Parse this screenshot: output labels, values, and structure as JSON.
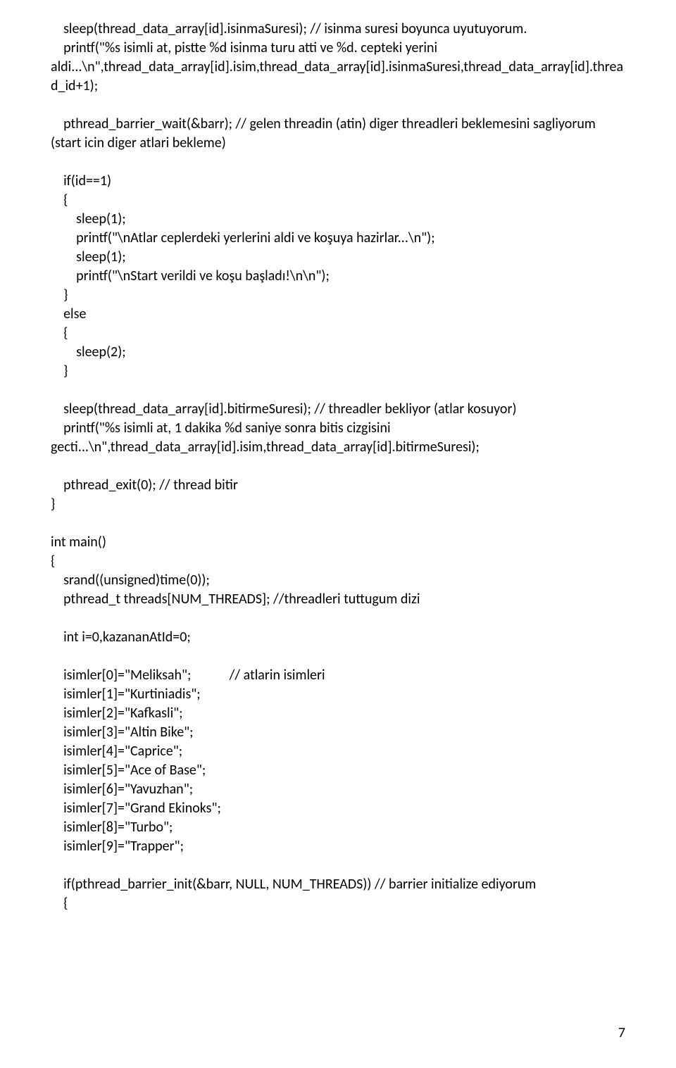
{
  "code": "    sleep(thread_data_array[id].isinmaSuresi); // isinma suresi boyunca uyutuyorum.\n    printf(\"%s isimli at, pistte %d isinma turu atti ve %d. cepteki yerini aldi...\\n\",thread_data_array[id].isim,thread_data_array[id].isinmaSuresi,thread_data_array[id].thread_id+1);\n\n    pthread_barrier_wait(&barr); // gelen threadin (atin) diger threadleri beklemesini sagliyorum (start icin diger atlari bekleme)\n\n    if(id==1)\n    {\n        sleep(1);\n        printf(\"\\nAtlar ceplerdeki yerlerini aldi ve koşuya hazirlar...\\n\");\n        sleep(1);\n        printf(\"\\nStart verildi ve koşu başladı!\\n\\n\");\n    }\n    else\n    {\n        sleep(2);\n    }\n\n    sleep(thread_data_array[id].bitirmeSuresi); // threadler bekliyor (atlar kosuyor)\n    printf(\"%s isimli at, 1 dakika %d saniye sonra bitis cizgisini gecti...\\n\",thread_data_array[id].isim,thread_data_array[id].bitirmeSuresi);\n\n    pthread_exit(0); // thread bitir\n}\n\nint main()\n{\n    srand((unsigned)time(0));\n    pthread_t threads[NUM_THREADS]; //threadleri tuttugum dizi\n\n    int i=0,kazananAtId=0;\n\n    isimler[0]=\"Meliksah\";            // atlarin isimleri\n    isimler[1]=\"Kurtiniadis\";\n    isimler[2]=\"Kafkasli\";\n    isimler[3]=\"Altin Bike\";\n    isimler[4]=\"Caprice\";\n    isimler[5]=\"Ace of Base\";\n    isimler[6]=\"Yavuzhan\";\n    isimler[7]=\"Grand Ekinoks\";\n    isimler[8]=\"Turbo\";\n    isimler[9]=\"Trapper\";\n\n    if(pthread_barrier_init(&barr, NULL, NUM_THREADS)) // barrier initialize ediyorum\n    {",
  "page_number": "7"
}
